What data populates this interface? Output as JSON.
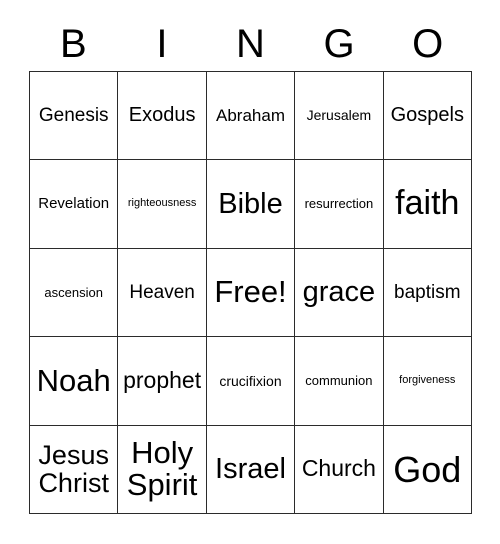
{
  "card": {
    "title": "BINGO",
    "header_letters": [
      "B",
      "I",
      "N",
      "G",
      "O"
    ],
    "grid_size": "5x5",
    "free_space_label": "Free!",
    "text_color": "#000000",
    "border_color": "#2b2b2b",
    "background_color": "#ffffff",
    "rows": [
      [
        {
          "label": "Genesis",
          "size": "ml"
        },
        {
          "label": "Exodus",
          "size": "l"
        },
        {
          "label": "Abraham",
          "size": "m"
        },
        {
          "label": "Jerusalem",
          "size": "s"
        },
        {
          "label": "Gospels",
          "size": "l"
        }
      ],
      [
        {
          "label": "Revelation",
          "size": "sm"
        },
        {
          "label": "righteousness",
          "size": "xxs"
        },
        {
          "label": "Bible",
          "size": "3xl"
        },
        {
          "label": "resurrection",
          "size": "xs"
        },
        {
          "label": "faith",
          "size": "5xl"
        }
      ],
      [
        {
          "label": "ascension",
          "size": "xs"
        },
        {
          "label": "Heaven",
          "size": "ml"
        },
        {
          "label": "Free!",
          "size": "4xl"
        },
        {
          "label": "grace",
          "size": "3xl"
        },
        {
          "label": "baptism",
          "size": "ml"
        }
      ],
      [
        {
          "label": "Noah",
          "size": "4xl"
        },
        {
          "label": "prophet",
          "size": "xl"
        },
        {
          "label": "crucifixion",
          "size": "s"
        },
        {
          "label": "communion",
          "size": "xs"
        },
        {
          "label": "forgiveness",
          "size": "xxs"
        }
      ],
      [
        {
          "label": "Jesus Christ",
          "size": "2xl"
        },
        {
          "label": "Holy Spirit",
          "size": "4xl"
        },
        {
          "label": "Israel",
          "size": "3xl"
        },
        {
          "label": "Church",
          "size": "xl"
        },
        {
          "label": "God",
          "size": "6xl"
        }
      ]
    ]
  }
}
